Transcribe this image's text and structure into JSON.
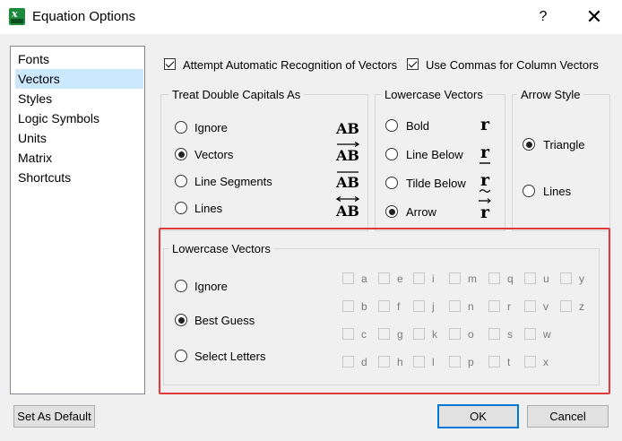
{
  "window": {
    "title": "Equation Options",
    "help_label": "?",
    "close_label": "✕"
  },
  "sidebar": {
    "items": [
      {
        "label": "Fonts"
      },
      {
        "label": "Vectors"
      },
      {
        "label": "Styles"
      },
      {
        "label": "Logic Symbols"
      },
      {
        "label": "Units"
      },
      {
        "label": "Matrix"
      },
      {
        "label": "Shortcuts"
      }
    ],
    "selected": "Vectors"
  },
  "options": {
    "auto_recognition_label": "Attempt Automatic Recognition of Vectors",
    "column_commas_label": "Use Commas for Column Vectors"
  },
  "double_capitals": {
    "title": "Treat Double Capitals As",
    "items": [
      {
        "label": "Ignore",
        "symbol": "AB"
      },
      {
        "label": "Vectors",
        "symbol": "AB"
      },
      {
        "label": "Line Segments",
        "symbol": "AB"
      },
      {
        "label": "Lines",
        "symbol": "AB"
      }
    ],
    "selected": "Vectors"
  },
  "lowercase_top": {
    "title": "Lowercase Vectors",
    "items": [
      {
        "label": "Bold",
        "symbol": "r"
      },
      {
        "label": "Line Below",
        "symbol": "r"
      },
      {
        "label": "Tilde Below",
        "symbol": "r"
      },
      {
        "label": "Arrow",
        "symbol": "r"
      }
    ],
    "selected": "Arrow"
  },
  "arrow_style": {
    "title": "Arrow Style",
    "items": [
      {
        "label": "Triangle"
      },
      {
        "label": "Lines"
      }
    ],
    "selected": "Triangle"
  },
  "lowercase_bottom": {
    "title": "Lowercase Vectors",
    "items": [
      {
        "label": "Ignore"
      },
      {
        "label": "Best Guess"
      },
      {
        "label": "Select Letters"
      }
    ],
    "selected": "Best Guess",
    "letters": [
      [
        "a",
        "e",
        "i",
        "m",
        "q",
        "u",
        "y"
      ],
      [
        "b",
        "f",
        "j",
        "n",
        "r",
        "v",
        "z"
      ],
      [
        "c",
        "g",
        "k",
        "o",
        "s",
        "w"
      ],
      [
        "d",
        "h",
        "l",
        "p",
        "t",
        "x"
      ]
    ]
  },
  "footer": {
    "default_label": "Set As Default",
    "ok_label": "OK",
    "cancel_label": "Cancel"
  }
}
